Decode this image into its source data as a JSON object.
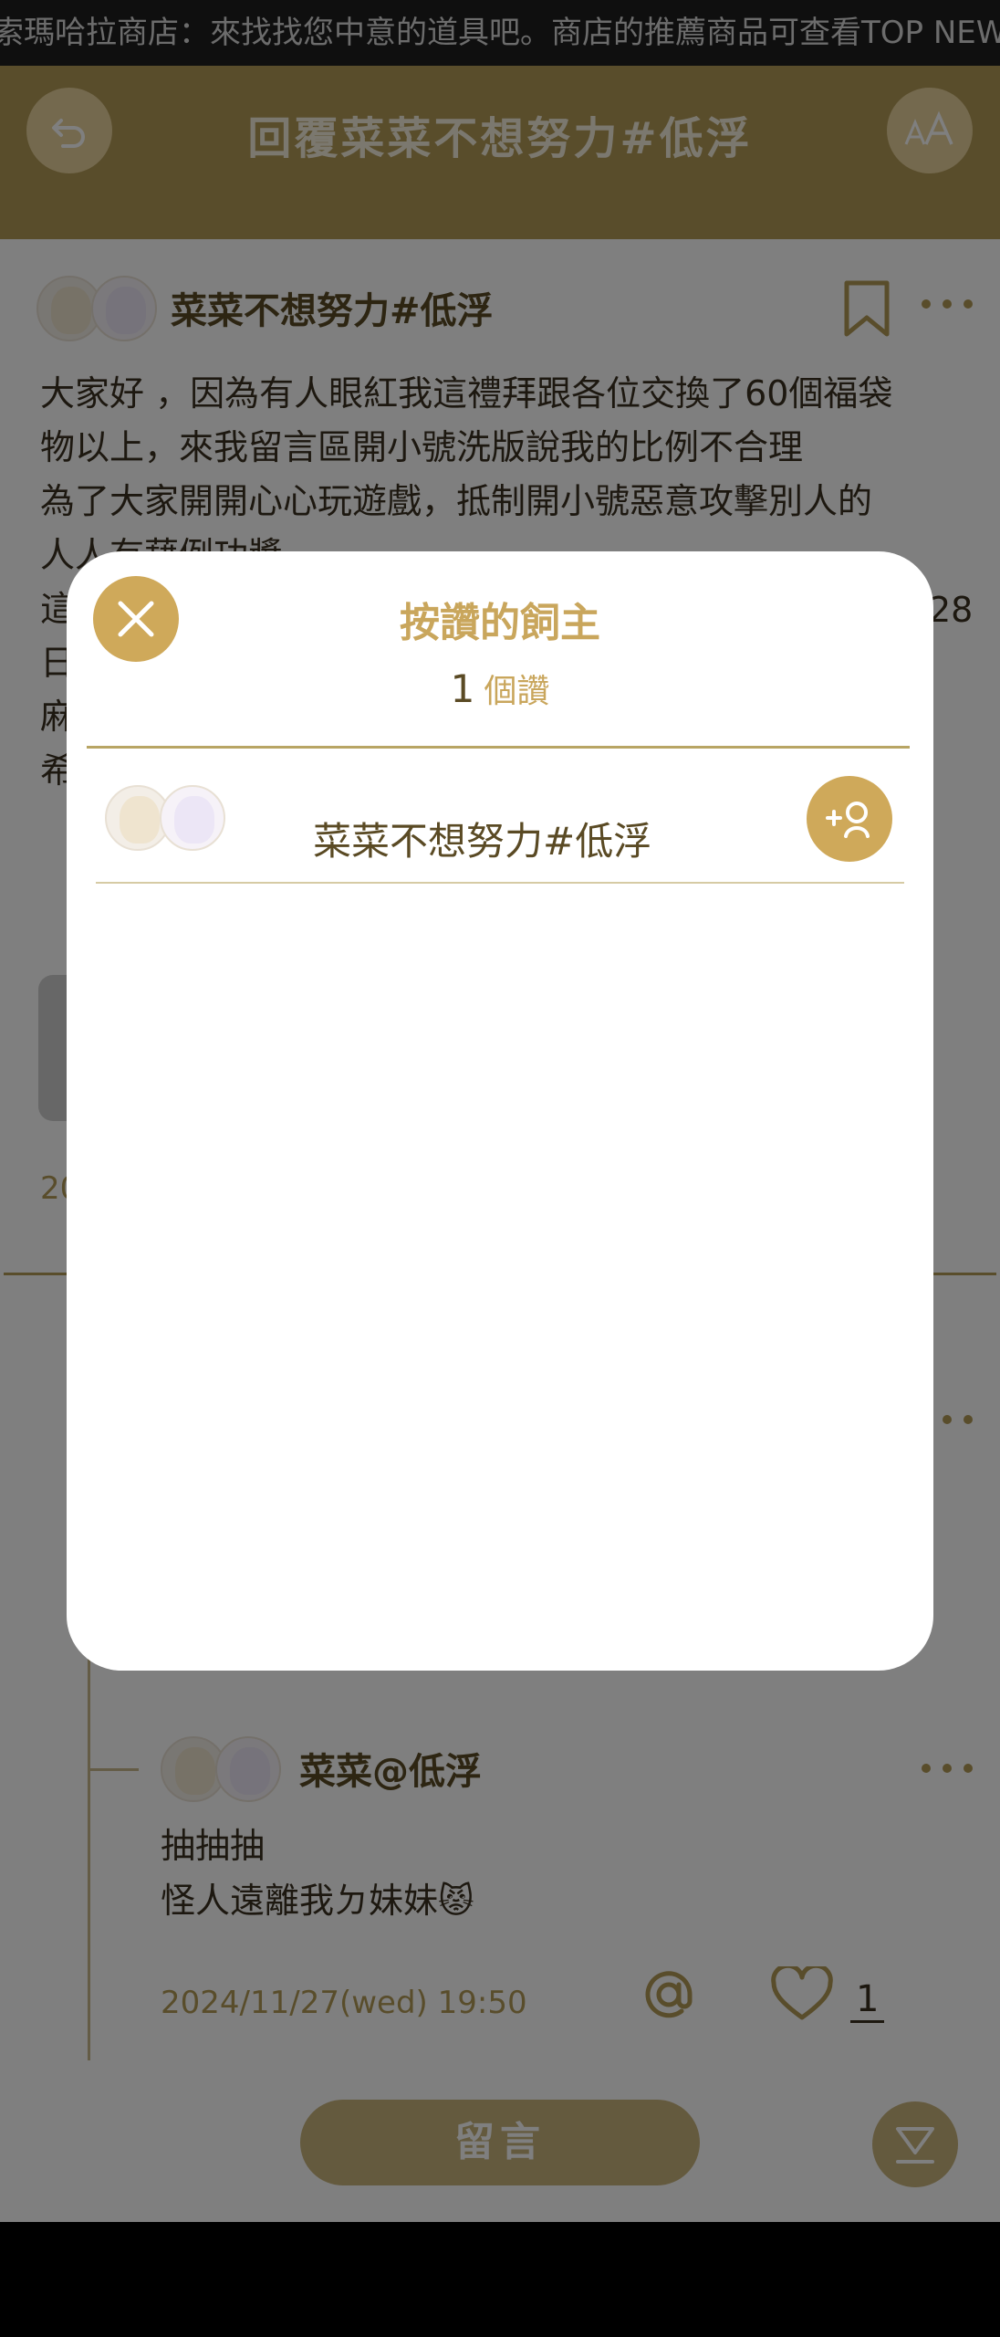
{
  "marquee": {
    "text": "索瑪哈拉商店：來找找您中意的道具吧。商店的推薦商品可查看TOP NEWS"
  },
  "header": {
    "title": "回覆菜菜不想努力#低浮"
  },
  "post": {
    "author": "菜菜不想努力#低浮",
    "lines": [
      "大家好 ，因為有人眼紅我這禮拜跟各位交換了60個福袋",
      "物以上，來我留言區開小號洗版說我的比例不合理",
      "為了大家開開心心玩遊戲，抵制開小號惡意攻擊別人的",
      "人人有藉例功獎",
      "這",
      "日",
      "麻",
      "希"
    ],
    "date_fragment": "20",
    "side_number": "28"
  },
  "reply": {
    "author": "菜菜@低浮",
    "lines": [
      "抽抽抽",
      "怪人遠離我ㄉ妹妹😾"
    ],
    "date": "2024/11/27(wed) 19:50",
    "like_count": "1"
  },
  "comment_button": {
    "label": "留言"
  },
  "modal": {
    "title": "按讚的飼主",
    "count_number": "1",
    "count_unit": "個讚",
    "likers": [
      {
        "name": "菜菜不想努力#低浮"
      }
    ]
  },
  "colors": {
    "accent": "#cfa95a",
    "header": "#b39a57",
    "text_brown": "#5a4a24"
  },
  "icons": {
    "back": "undo-arrow-icon",
    "font": "font-size-icon",
    "close": "close-icon",
    "follow": "follow-user-icon",
    "bookmark": "bookmark-icon",
    "more": "more-dots-icon",
    "mention": "at-icon",
    "like": "heart-icon",
    "scroll": "scroll-bottom-icon"
  }
}
